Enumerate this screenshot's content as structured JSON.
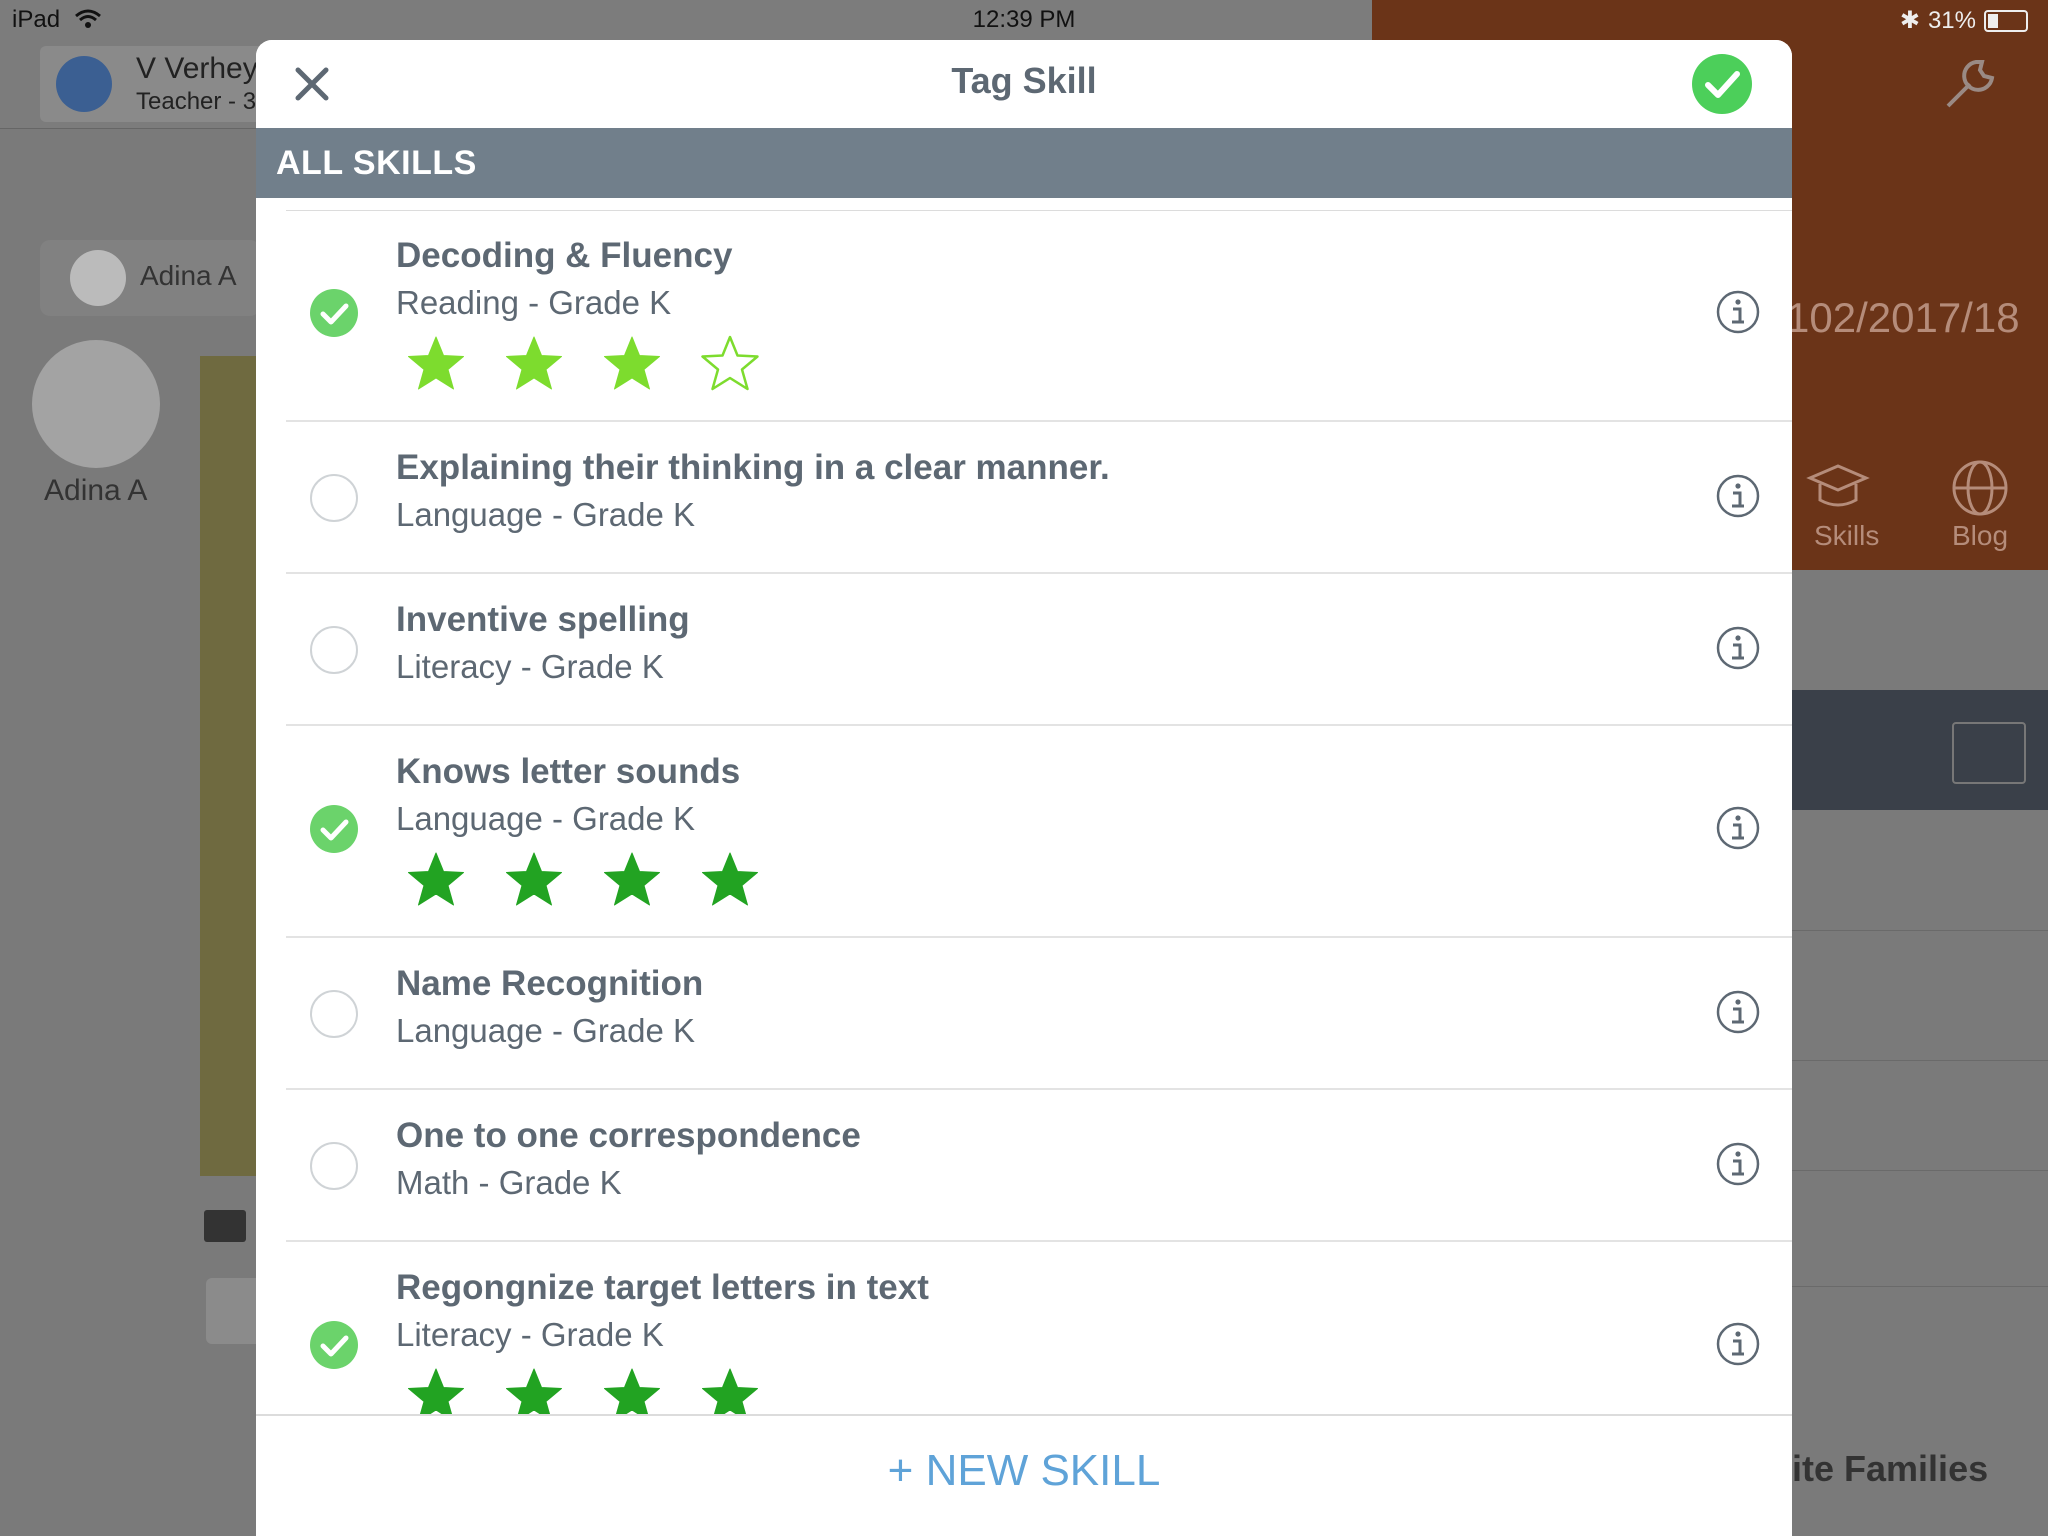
{
  "status_bar": {
    "device": "iPad",
    "time": "12:39 PM",
    "battery": "31%"
  },
  "background": {
    "teacher_name": "V Verheye",
    "teacher_role": "Teacher - 3",
    "student_name": "Adina A",
    "date_text": "102/2017/18",
    "tabs": [
      {
        "label": "Skills",
        "icon": "graduation-cap-icon"
      },
      {
        "label": "Blog",
        "icon": "globe-icon"
      }
    ],
    "invite_text": "vite Families"
  },
  "modal": {
    "title": "Tag Skill",
    "section_header": "ALL SKILLS",
    "new_skill_label": "+ NEW SKILL",
    "colors": {
      "check_on": "#6bd36b",
      "star_light": "#7ddc2e",
      "star_dark": "#22a322",
      "link": "#5fa3d8"
    },
    "skills": [
      {
        "name": "Decoding & Fluency",
        "subtitle": "Reading - Grade K",
        "checked": true,
        "rating": 3,
        "star_color": "light"
      },
      {
        "name": "Explaining their thinking in a clear manner.",
        "subtitle": "Language - Grade K",
        "checked": false
      },
      {
        "name": "Inventive spelling",
        "subtitle": "Literacy - Grade K",
        "checked": false
      },
      {
        "name": "Knows letter sounds",
        "subtitle": "Language - Grade K",
        "checked": true,
        "rating": 4,
        "star_color": "dark"
      },
      {
        "name": "Name Recognition",
        "subtitle": "Language - Grade K",
        "checked": false
      },
      {
        "name": "One to one correspondence",
        "subtitle": "Math - Grade K",
        "checked": false
      },
      {
        "name": "Regongnize target letters in text",
        "subtitle": "Literacy - Grade K",
        "checked": true,
        "rating": 4,
        "star_color": "dark"
      }
    ]
  }
}
